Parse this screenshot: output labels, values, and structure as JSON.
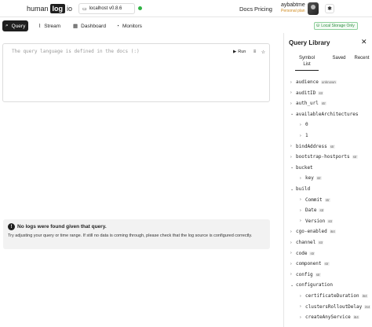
{
  "header": {
    "logo_left": "human",
    "logo_box": "log",
    "logo_right": "io",
    "environment": "localhost v0.8.6",
    "nav_docs": "Docs",
    "nav_pricing": "Pricing",
    "user_name": "aybabtme",
    "user_plan": "Personal plan"
  },
  "tabs": [
    {
      "label": "Query",
      "icon": "search-icon"
    },
    {
      "label": "Stream",
      "icon": "stream-icon"
    },
    {
      "label": "Dashboard",
      "icon": "dashboard-icon"
    },
    {
      "label": "Monitors",
      "icon": "bell-icon"
    }
  ],
  "storage_badge": "Local Storage Only",
  "query": {
    "placeholder": "The query language is defined in the docs (:)",
    "run_label": "Run"
  },
  "nologs": {
    "title": "No logs were found given that query.",
    "message": "Try adjusting your query or time range. If still no data is coming through, please check that the log source is configured correctly."
  },
  "library": {
    "title": "Query Library",
    "tabs": [
      {
        "label": "Symbol List",
        "active": true
      },
      {
        "label": "Saved",
        "active": false
      },
      {
        "label": "Recent",
        "active": false
      }
    ],
    "symbols": [
      {
        "name": "audience",
        "type": "unknown",
        "caret": "›",
        "depth": 0
      },
      {
        "name": "auditID",
        "type": "str",
        "caret": "›",
        "depth": 0
      },
      {
        "name": "auth_url",
        "type": "str",
        "caret": "›",
        "depth": 0
      },
      {
        "name": "availableArchitectures",
        "type": "",
        "caret": "⌄",
        "depth": 0
      },
      {
        "name": "0",
        "type": "",
        "caret": "›",
        "depth": 1
      },
      {
        "name": "1",
        "type": "",
        "caret": "›",
        "depth": 1
      },
      {
        "name": "bindAddress",
        "type": "str",
        "caret": "›",
        "depth": 0
      },
      {
        "name": "bootstrap-hostports",
        "type": "str",
        "caret": "›",
        "depth": 0
      },
      {
        "name": "bucket",
        "type": "",
        "caret": "⌄",
        "depth": 0
      },
      {
        "name": "key",
        "type": "str",
        "caret": "›",
        "depth": 1
      },
      {
        "name": "build",
        "type": "",
        "caret": "⌄",
        "depth": 0
      },
      {
        "name": "Commit",
        "type": "str",
        "caret": "›",
        "depth": 1
      },
      {
        "name": "Date",
        "type": "str",
        "caret": "›",
        "depth": 1
      },
      {
        "name": "Version",
        "type": "str",
        "caret": "›",
        "depth": 1
      },
      {
        "name": "cgo-enabled",
        "type": "i64",
        "caret": "›",
        "depth": 0
      },
      {
        "name": "channel",
        "type": "str",
        "caret": "›",
        "depth": 0
      },
      {
        "name": "code",
        "type": "str",
        "caret": "›",
        "depth": 0
      },
      {
        "name": "component",
        "type": "str",
        "caret": "›",
        "depth": 0
      },
      {
        "name": "config",
        "type": "str",
        "caret": "›",
        "depth": 0
      },
      {
        "name": "configuration",
        "type": "",
        "caret": "⌄",
        "depth": 0
      },
      {
        "name": "certificateDuration",
        "type": "i64",
        "caret": "›",
        "depth": 1
      },
      {
        "name": "clustersRolloutDelay",
        "type": "i64",
        "caret": "›",
        "depth": 1
      },
      {
        "name": "createAnyService",
        "type": "i64",
        "caret": "›",
        "depth": 1
      }
    ]
  },
  "colors": {
    "accent_dark": "#1f1f1f",
    "status_green": "#2fb344",
    "plan_orange": "#d08a1e"
  }
}
